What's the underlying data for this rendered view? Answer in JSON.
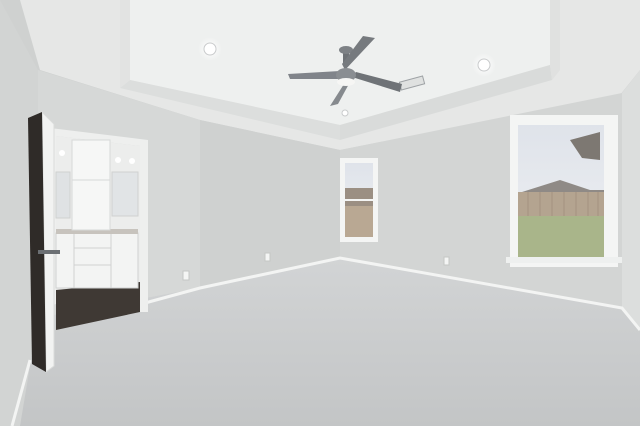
{
  "scene": {
    "type": "photo",
    "subject": "empty-bedroom-interior",
    "colors": {
      "ceiling": "#e9eae9",
      "tray_ceiling": "#f1f2f1",
      "wall_left": "#d6d8d7",
      "wall_back": "#d3d5d4",
      "wall_right": "#dcdedd",
      "carpet": "#c9cbcc",
      "trim": "#f4f5f4",
      "floor_wood": "#3f3934",
      "sky": "#e6e9ee",
      "grass": "#a9b58a",
      "fence": "#b9a893"
    },
    "objects": [
      "tray-ceiling",
      "ceiling-fan",
      "recessed-lights",
      "hvac-vent",
      "doorway-to-bathroom",
      "bathroom-vanity",
      "open-door",
      "window-small",
      "window-large",
      "baseboards",
      "wall-outlets",
      "carpet-floor"
    ]
  }
}
